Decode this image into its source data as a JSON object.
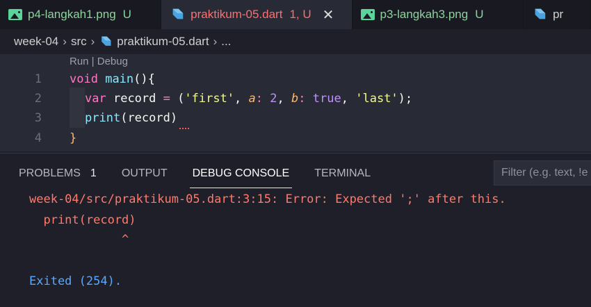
{
  "tabs": [
    {
      "name": "p4-langkah1.png",
      "status": "U",
      "icon": "image-icon"
    },
    {
      "name": "praktikum-05.dart",
      "status": "1, U",
      "icon": "dart-icon",
      "active": true
    },
    {
      "name": "p3-langkah3.png",
      "status": "U",
      "icon": "image-icon"
    },
    {
      "name": "pr",
      "status": "",
      "icon": "dart-icon"
    }
  ],
  "breadcrumb": {
    "folder": "week-04",
    "subfolder": "src",
    "file": "praktikum-05.dart",
    "more": "..."
  },
  "codelens": "Run | Debug",
  "code": {
    "line_numbers": [
      "1",
      "2",
      "3",
      "4"
    ],
    "l1": {
      "kw": "void",
      "fn": "main",
      "paren": "(){"
    },
    "l2": {
      "kw": "var",
      "name": "record",
      "eq": "=",
      "open": "(",
      "s1": "'first'",
      "c1": ",",
      "na": "a",
      "colon1": ":",
      "v2": "2",
      "c2": ",",
      "nb": "b",
      "colon2": ":",
      "vt": "true",
      "c3": ",",
      "s2": "'last'",
      "close": ");"
    },
    "l3": {
      "fn": "print",
      "open": "(",
      "arg": "record",
      "close": ")"
    },
    "l4": {
      "brace": "}"
    }
  },
  "panel": {
    "tabs": [
      "PROBLEMS",
      "OUTPUT",
      "DEBUG CONSOLE",
      "TERMINAL"
    ],
    "problems_count": "1",
    "filter_placeholder": "Filter (e.g. text, !e",
    "output": {
      "error": "week-04/src/praktikum-05.dart:3:15: Error: Expected ';' after this.",
      "code": "  print(record)",
      "caret": "             ^",
      "exit": "Exited (254)."
    }
  },
  "colors": {
    "error": "#ff7a6e",
    "exit": "#5aa8ff",
    "active_tab": "#ff6e6e",
    "untracked": "#8bd49c"
  }
}
